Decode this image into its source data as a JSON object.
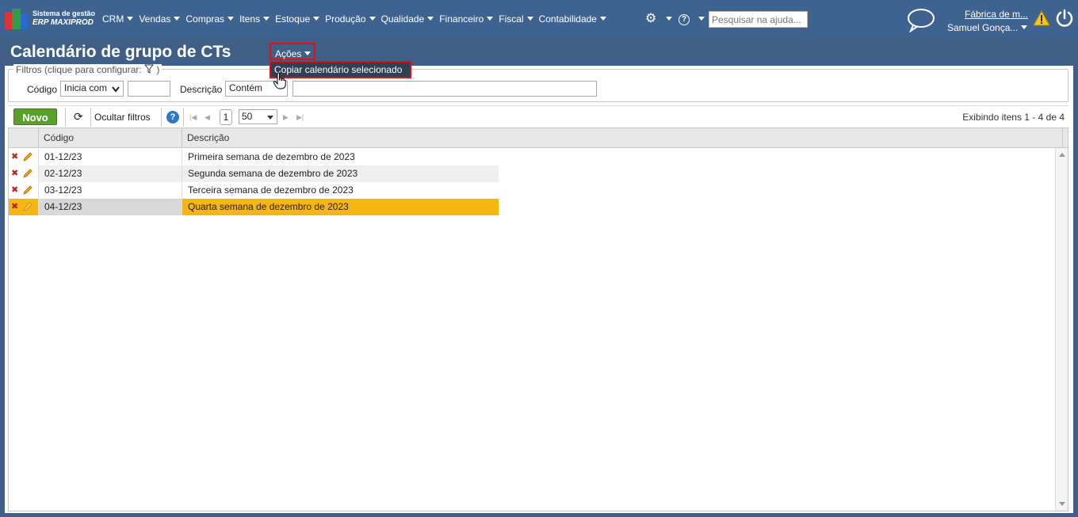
{
  "brand": {
    "line1": "Sistema de gestão",
    "line2": "ERP MAXIPROD"
  },
  "menu": [
    "CRM",
    "Vendas",
    "Compras",
    "Itens",
    "Estoque",
    "Produção",
    "Qualidade",
    "Financeiro",
    "Fiscal",
    "Contabilidade"
  ],
  "help_search": {
    "placeholder": "Pesquisar na ajuda..."
  },
  "company": "Fábrica de m...",
  "user": "Samuel Gonça...",
  "page": {
    "title": "Calendário de grupo de CTs",
    "actions_label": "Ações",
    "actions_menu_item": "Copiar calendário selecionado"
  },
  "filters": {
    "legend": "Filtros (clique para configurar:",
    "legend_end": ")",
    "codigo_label": "Código",
    "codigo_op": "Inicia com",
    "codigo_value": "",
    "descricao_label": "Descrição",
    "descricao_op": "Contém",
    "descricao_value": ""
  },
  "toolbar": {
    "novo": "Novo",
    "ocultar": "Ocultar filtros",
    "page_number": "1",
    "page_size": "50",
    "info": "Exibindo itens 1 - 4 de 4"
  },
  "table": {
    "headers": [
      "Código",
      "Descrição"
    ],
    "rows": [
      {
        "codigo": "01-12/23",
        "descricao": "Primeira semana de dezembro de 2023"
      },
      {
        "codigo": "02-12/23",
        "descricao": "Segunda semana de dezembro de 2023"
      },
      {
        "codigo": "03-12/23",
        "descricao": "Terceira semana de dezembro de 2023"
      },
      {
        "codigo": "04-12/23",
        "descricao": "Quarta semana de dezembro de 2023"
      }
    ],
    "selected_row": 3
  },
  "colors": {
    "nav": "#3f6391",
    "title_bar": "#3f5f86",
    "selected": "#f5b614",
    "novo": "#5aa02c",
    "highlight_border": "#e01010"
  }
}
